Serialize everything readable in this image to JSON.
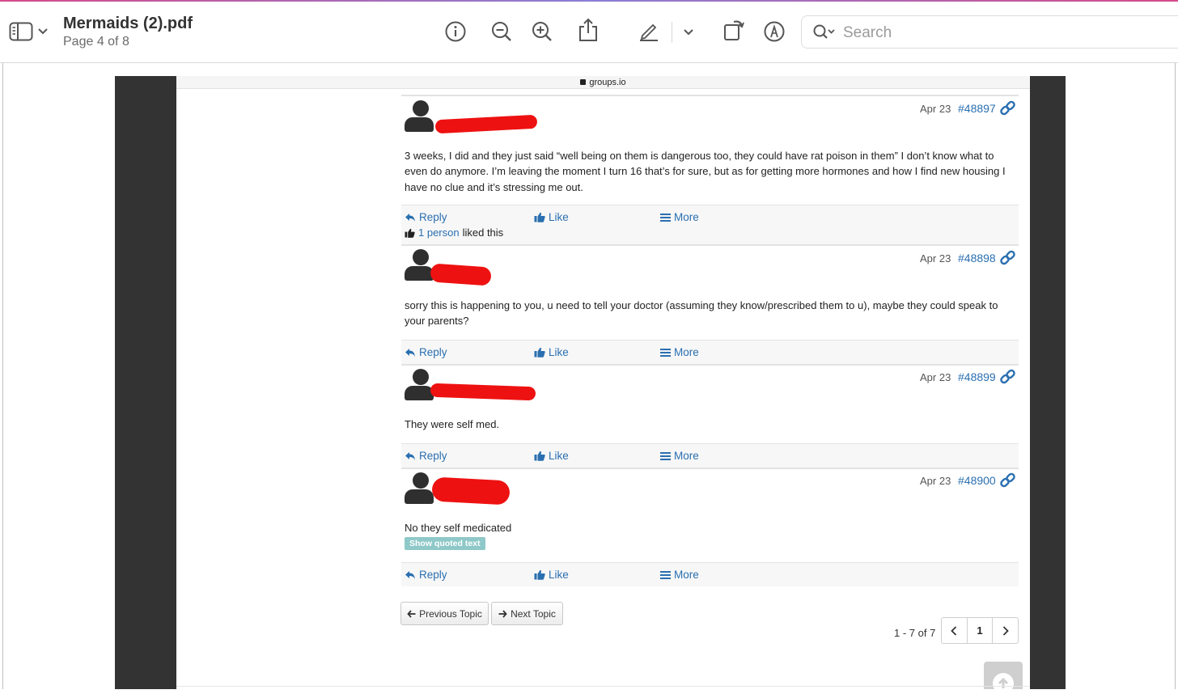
{
  "toolbar": {
    "title": "Mermaids (2).pdf",
    "subtitle": "Page 4 of 8",
    "search_placeholder": "Search",
    "icons": [
      "sidebar-icon",
      "chevron-down-icon",
      "info-icon",
      "zoom-out-icon",
      "zoom-in-icon",
      "share-icon",
      "markup-pen-icon",
      "chevron-down-icon",
      "rotate-icon",
      "annotate-icon",
      "search-icon"
    ]
  },
  "browser": {
    "url": "groups.io"
  },
  "messages": [
    {
      "date": "Apr 23",
      "number": "#48897",
      "text": "3 weeks, I did and they just said “well being on them is dangerous too, they could have rat poison in them” I don’t know what to even do anymore. I’m leaving the moment I turn 16 that’s for sure, but as for getting more hormones and how I find new housing I have no clue and it’s stressing me out.",
      "liked_count": "1 person",
      "liked_suffix": "liked this"
    },
    {
      "date": "Apr 23",
      "number": "#48898",
      "text": "sorry this is happening to you, u need to tell your doctor (assuming they know/prescribed them to u), maybe they could speak to your parents?"
    },
    {
      "date": "Apr 23",
      "number": "#48899",
      "text": "They were self med."
    },
    {
      "date": "Apr 23",
      "number": "#48900",
      "text": "No they self medicated",
      "show_quoted": "Show quoted text"
    }
  ],
  "actions": {
    "reply": "Reply",
    "like": "Like",
    "more": "More"
  },
  "navigation": {
    "previous": "Previous Topic",
    "next": "Next Topic",
    "count": "1 - 7 of 7",
    "page_prev": "‹",
    "current_page": "1",
    "page_next": "›"
  },
  "colors": {
    "link": "#2a6fb0",
    "redaction": "#ee1111",
    "page_margin": "#333333"
  }
}
